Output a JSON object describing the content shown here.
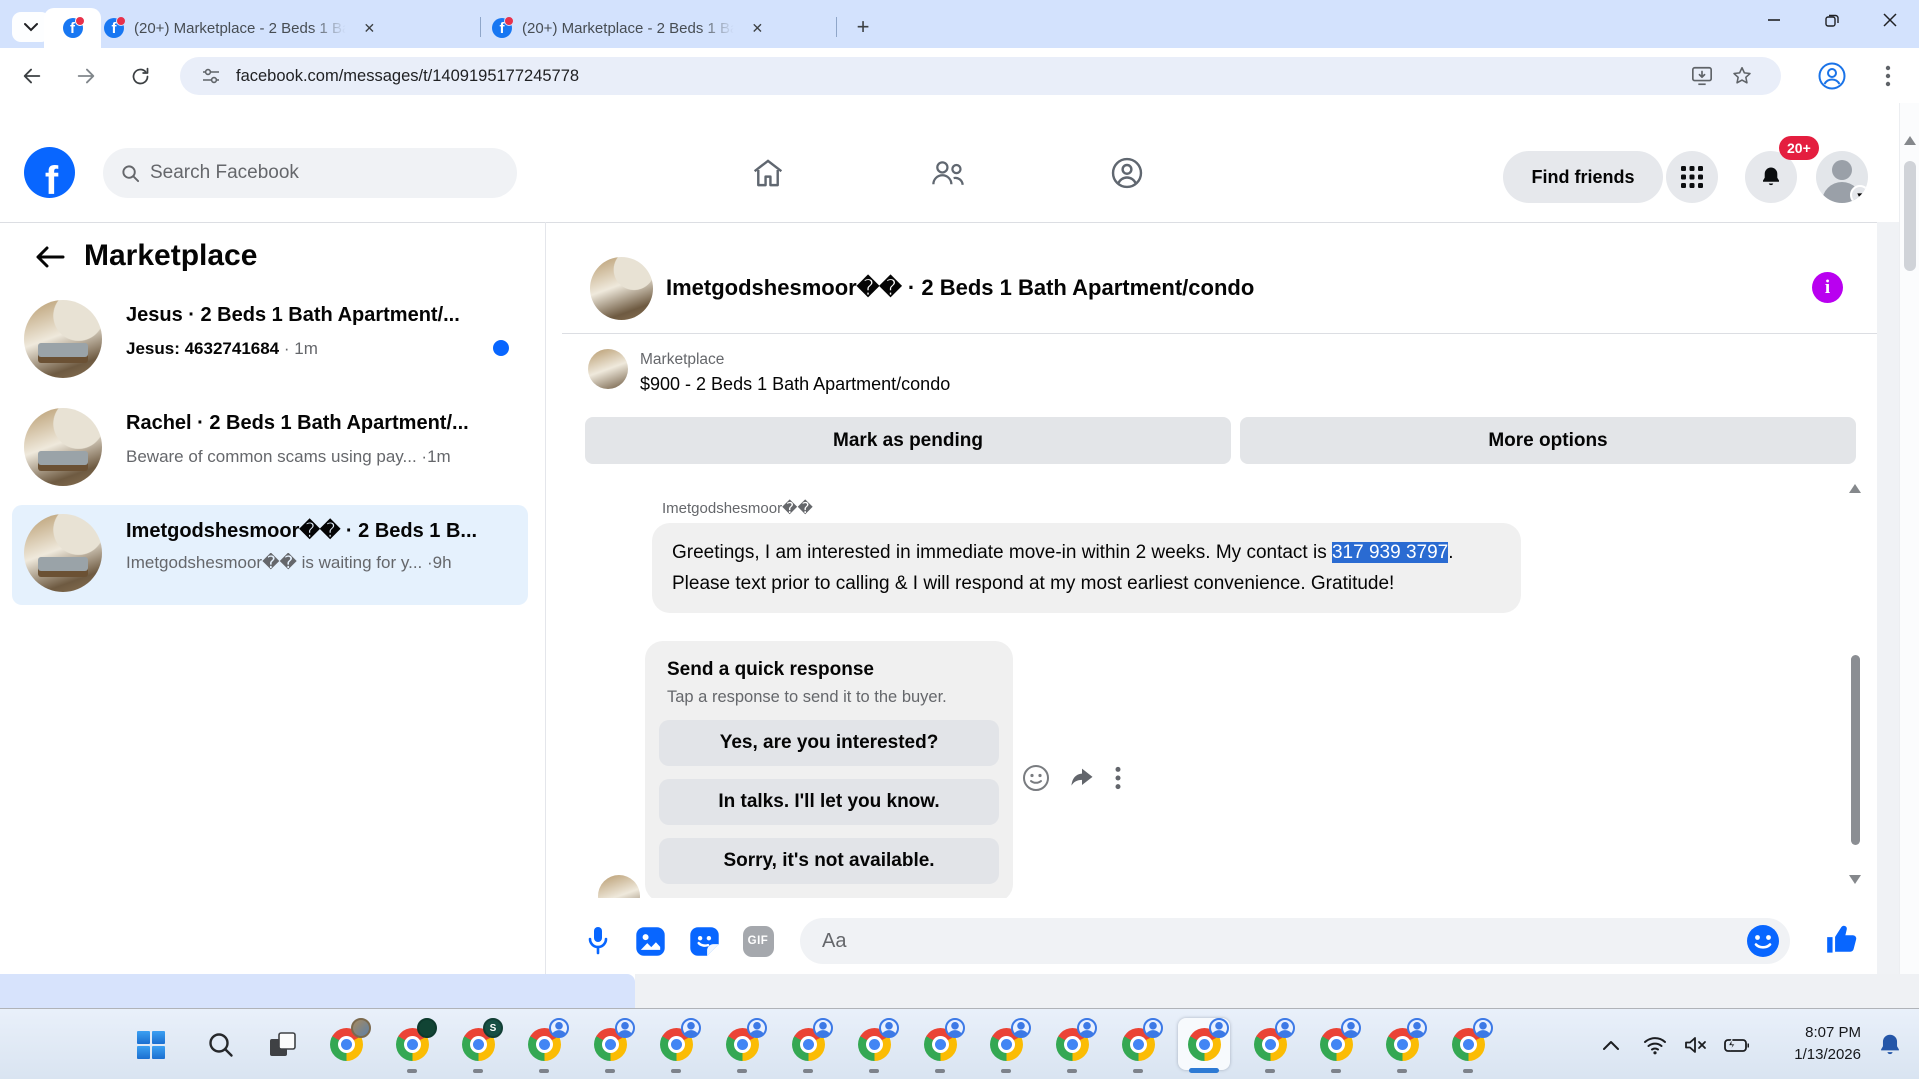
{
  "browser": {
    "tabs": [
      "(20+) Marketplace - 2 Beds 1 Ba",
      "(20+) Marketplace - 2 Beds 1 Ba"
    ],
    "url": "facebook.com/messages/t/1409195177245778"
  },
  "header": {
    "search_placeholder": "Search Facebook",
    "find_friends_label": "Find friends",
    "notification_badge": "20+"
  },
  "sidebar": {
    "title": "Marketplace",
    "conversations": [
      {
        "title": "Jesus · 2 Beds 1 Bath Apartment/...",
        "snippet": "Jesus: 4632741684",
        "time": " · 1m"
      },
      {
        "title": "Rachel · 2 Beds 1 Bath Apartment/...",
        "snippet": "Beware of common scams using pay...",
        "time": " ·1m"
      },
      {
        "title": "Imetgodshesmoor�� · 2 Beds 1 B...",
        "snippet": "Imetgodshesmoor�� is waiting for y...",
        "time": " ·9h"
      }
    ]
  },
  "chat": {
    "title": "Imetgodshesmoor�� · 2 Beds 1 Bath Apartment/condo",
    "context_label": "Marketplace",
    "listing": "$900 - 2 Beds 1 Bath Apartment/condo",
    "mark_pending_label": "Mark as pending",
    "more_options_label": "More options",
    "sender": "Imetgodshesmoor��",
    "message_before": "Greetings, I am interested in immediate move-in within 2 weeks. My contact is ",
    "message_highlight": "317 939 3797",
    "message_after": ". Please text prior to calling & I will respond at my most earliest convenience. Gratitude!",
    "quick_title": "Send a quick response",
    "quick_subtitle": "Tap a response to send it to the buyer.",
    "quick_options": [
      "Yes, are you interested?",
      "In talks. I'll let you know.",
      "Sorry, it's not available."
    ],
    "composer_placeholder": "Aa",
    "gif_label": "GIF"
  },
  "taskbar": {
    "time": "8:07 PM",
    "date": "1/13/2026",
    "profile_badge_s": "S"
  },
  "colors": {
    "accent_blue": "#0866ff",
    "selection_blue": "#2a6bd2",
    "info_purple": "#b900f0",
    "badge_red": "#e41e3f"
  }
}
